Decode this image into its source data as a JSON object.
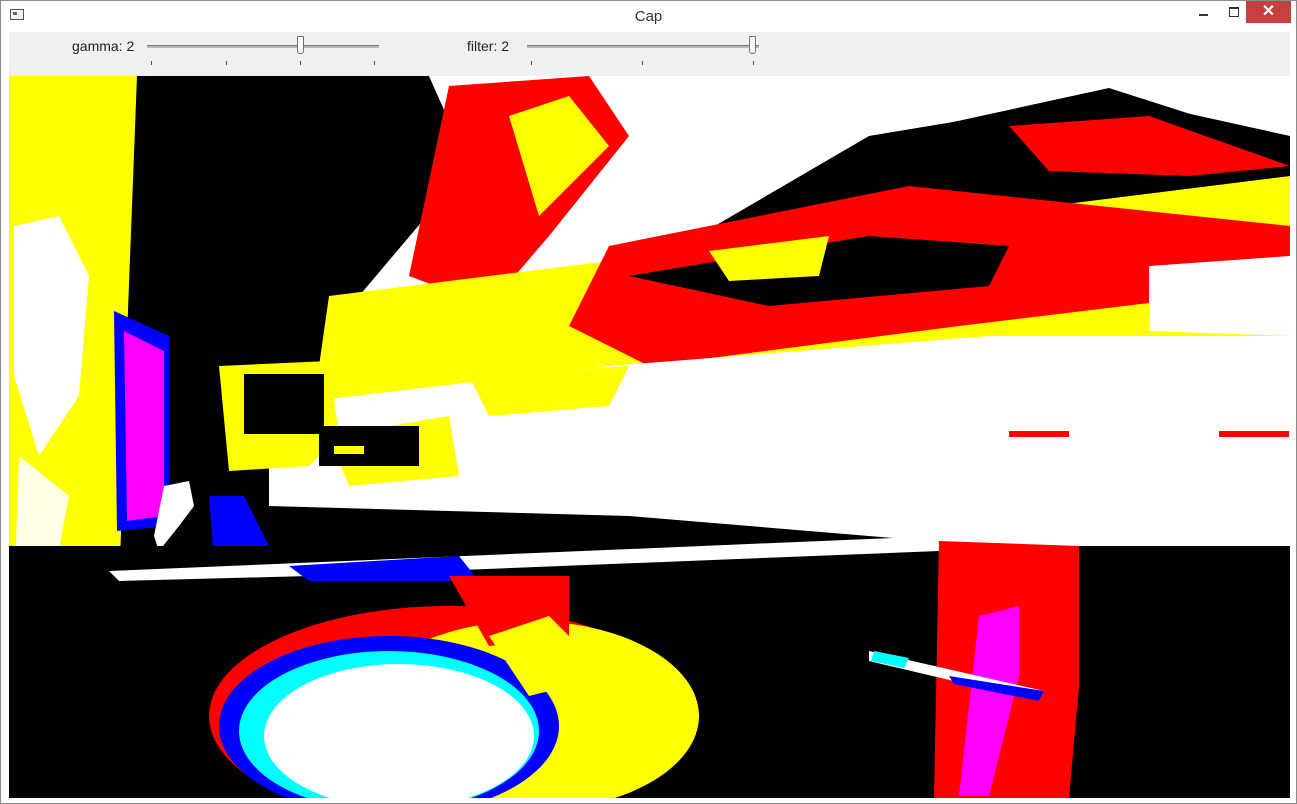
{
  "window": {
    "title": "Cap",
    "controls": {
      "minimize_icon": "minimize-icon",
      "maximize_icon": "maximize-icon",
      "close_icon": "close-icon",
      "close_glyph": "✕"
    },
    "app_icon": "window-icon"
  },
  "trackbars": [
    {
      "label": "gamma: 2",
      "value": 2
    },
    {
      "label": "filter: 2",
      "value": 2
    }
  ],
  "image": {
    "description_colors": {
      "white": "#ffffff",
      "yellow": "#ffff00",
      "red": "#ff0000",
      "magenta": "#ff00ff",
      "blue": "#0000ff",
      "cyan": "#00ffff",
      "black": "#000000"
    }
  }
}
